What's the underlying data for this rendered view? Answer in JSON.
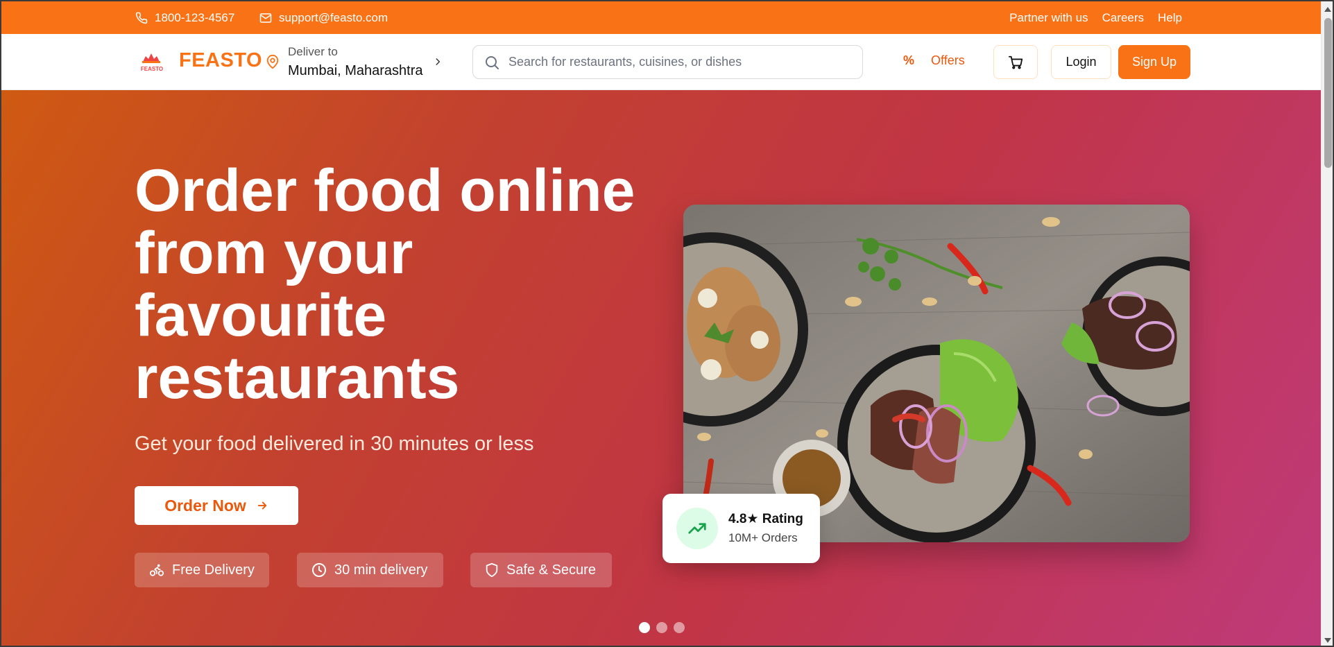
{
  "topbar": {
    "phone": "1800-123-4567",
    "email": "support@feasto.com",
    "links": [
      "Partner with us",
      "Careers",
      "Help"
    ]
  },
  "header": {
    "logo_mark_text": "FEASTO",
    "logo_text": "FEASTO",
    "deliver_label": "Deliver to",
    "deliver_city": "Mumbai, Maharashtra",
    "search_placeholder": "Search for restaurants, cuisines, or dishes",
    "offers_label": "Offers",
    "login_label": "Login",
    "signup_label": "Sign Up"
  },
  "hero": {
    "title": "Order food online from your favourite restaurants",
    "subtitle": "Get your food delivered in 30 minutes or less",
    "cta_label": "Order Now",
    "features": [
      "Free Delivery",
      "30 min delivery",
      "Safe & Secure"
    ],
    "rating_title": "4.8★ Rating",
    "rating_sub": "10M+ Orders",
    "slides_count": 3,
    "active_slide": 1
  },
  "colors": {
    "brand": "#f97316",
    "brand_dark": "#ea580c",
    "rating_icon": "#16a34a"
  },
  "icons": {
    "phone": "phone-icon",
    "email": "mail-icon",
    "location": "map-pin-icon",
    "search": "search-icon",
    "offers": "percent-icon",
    "cart": "cart-icon",
    "cta": "arrow-right-icon",
    "delivery": "bike-icon",
    "time": "clock-icon",
    "secure": "shield-icon",
    "rating": "trending-up-icon"
  }
}
